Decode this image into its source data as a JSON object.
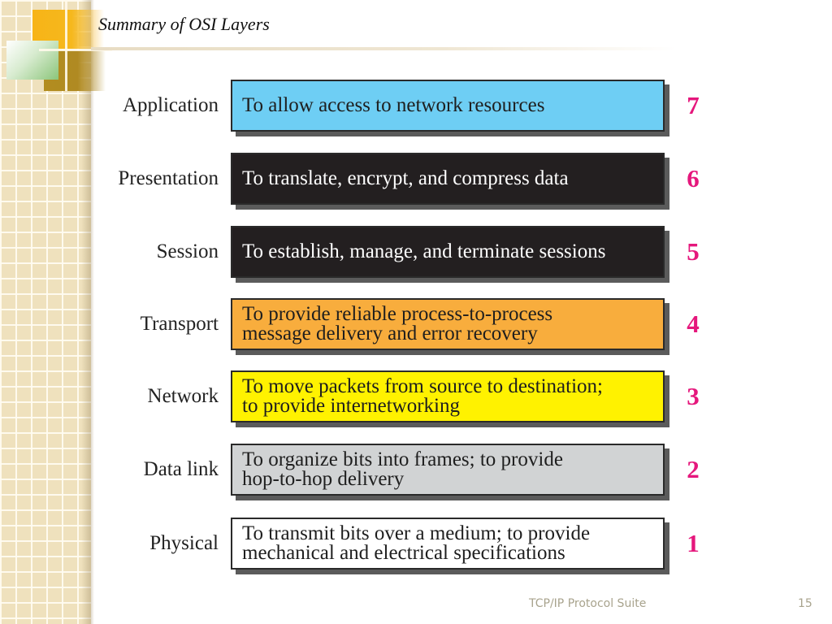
{
  "slide": {
    "title": "Summary of OSI Layers",
    "footer": "TCP/IP Protocol Suite",
    "page_number": "15"
  },
  "layers": [
    {
      "name": "Application",
      "description": "To allow access to network resources",
      "number": "7",
      "fill": "#6ecef4",
      "text_color": "#1e1e1e"
    },
    {
      "name": "Presentation",
      "description": "To translate, encrypt, and compress data",
      "number": "6",
      "fill": "#231f20",
      "text_color": "#ffffff"
    },
    {
      "name": "Session",
      "description": "To establish, manage, and terminate sessions",
      "number": "5",
      "fill": "#231f20",
      "text_color": "#ffffff"
    },
    {
      "name": "Transport",
      "description": "To provide reliable process-to-process\nmessage delivery and error recovery",
      "number": "4",
      "fill": "#f8ad3d",
      "text_color": "#1e1e1e"
    },
    {
      "name": "Network",
      "description": "To move packets from source to destination;\nto provide internetworking",
      "number": "3",
      "fill": "#fff200",
      "text_color": "#1e1e1e"
    },
    {
      "name": "Data link",
      "description": "To organize bits into frames; to provide\nhop-to-hop delivery",
      "number": "2",
      "fill": "#d1d3d4",
      "text_color": "#1e1e1e"
    },
    {
      "name": "Physical",
      "description": "To transmit bits over a medium; to provide\nmechanical and electrical specifications",
      "number": "1",
      "fill": "#ffffff",
      "text_color": "#1e1e1e"
    }
  ],
  "colors": {
    "layer_number": "#e5177c"
  }
}
